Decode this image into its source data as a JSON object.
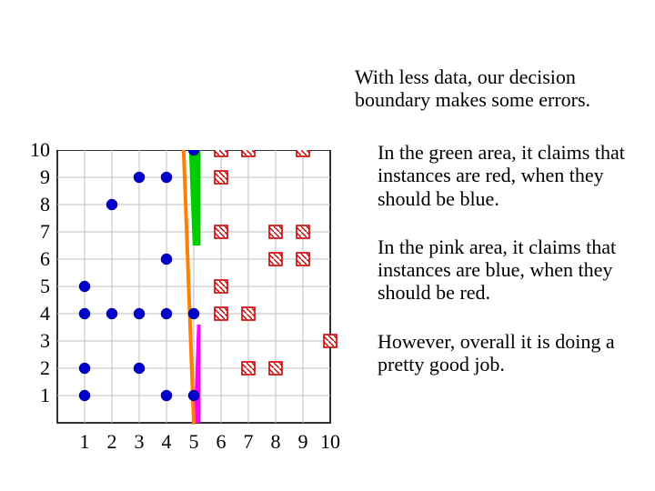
{
  "caption": {
    "top": "With less data, our decision boundary makes some errors."
  },
  "paragraphs": {
    "p1": "In the green area, it claims that instances are red, when they should be blue.",
    "p2": "In the pink area, it claims that instances are blue, when they should be red.",
    "p3": "However, overall it is doing a pretty good job."
  },
  "axis": {
    "y10": "10",
    "y9": "9",
    "y8": "8",
    "y7": "7",
    "y6": "6",
    "y5": "5",
    "y4": "4",
    "y3": "3",
    "y2": "2",
    "y1": "1",
    "x1": "1",
    "x2": "2",
    "x3": "3",
    "x4": "4",
    "x5": "5",
    "x6": "6",
    "x7": "7",
    "x8": "8",
    "x9": "9",
    "x10": "10"
  },
  "chart_data": {
    "type": "scatter",
    "title": "",
    "xlabel": "",
    "ylabel": "",
    "xlim": [
      0,
      10
    ],
    "ylim": [
      0,
      10
    ],
    "grid": true,
    "series": [
      {
        "name": "blue",
        "marker": "solid-circle",
        "color": "#0000cc",
        "points": [
          {
            "x": 1,
            "y": 1
          },
          {
            "x": 1,
            "y": 2
          },
          {
            "x": 1,
            "y": 4
          },
          {
            "x": 1,
            "y": 5
          },
          {
            "x": 2,
            "y": 4
          },
          {
            "x": 2,
            "y": 8
          },
          {
            "x": 3,
            "y": 2
          },
          {
            "x": 3,
            "y": 4
          },
          {
            "x": 3,
            "y": 9
          },
          {
            "x": 4,
            "y": 1
          },
          {
            "x": 4,
            "y": 4
          },
          {
            "x": 4,
            "y": 6
          },
          {
            "x": 4,
            "y": 9
          },
          {
            "x": 5,
            "y": 1
          },
          {
            "x": 5,
            "y": 4
          },
          {
            "x": 5,
            "y": 10
          }
        ]
      },
      {
        "name": "red",
        "marker": "hatched-square",
        "color": "#cc0000",
        "points": [
          {
            "x": 6,
            "y": 4
          },
          {
            "x": 6,
            "y": 5
          },
          {
            "x": 6,
            "y": 7
          },
          {
            "x": 6,
            "y": 9
          },
          {
            "x": 6,
            "y": 10
          },
          {
            "x": 7,
            "y": 2
          },
          {
            "x": 7,
            "y": 4
          },
          {
            "x": 7,
            "y": 10
          },
          {
            "x": 8,
            "y": 2
          },
          {
            "x": 8,
            "y": 6
          },
          {
            "x": 8,
            "y": 7
          },
          {
            "x": 9,
            "y": 6
          },
          {
            "x": 9,
            "y": 7
          },
          {
            "x": 9,
            "y": 10
          },
          {
            "x": 10,
            "y": 3
          }
        ]
      }
    ],
    "decision_line": {
      "p1": {
        "x": 5.0,
        "y": 0
      },
      "p2": {
        "x": 4.6,
        "y": 10.8
      },
      "color": "#ff7f00",
      "width": 4
    },
    "error_regions": [
      {
        "name": "green",
        "color": "#00cc00",
        "poly": [
          [
            4.8,
            10.6
          ],
          [
            5.25,
            10.6
          ],
          [
            5.25,
            6.5
          ],
          [
            4.96,
            6.5
          ]
        ]
      },
      {
        "name": "magenta",
        "color": "#ff00ff",
        "poly": [
          [
            5.25,
            3.6
          ],
          [
            5.25,
            0.0
          ],
          [
            5.0,
            0.0
          ],
          [
            5.12,
            3.6
          ]
        ]
      }
    ]
  }
}
